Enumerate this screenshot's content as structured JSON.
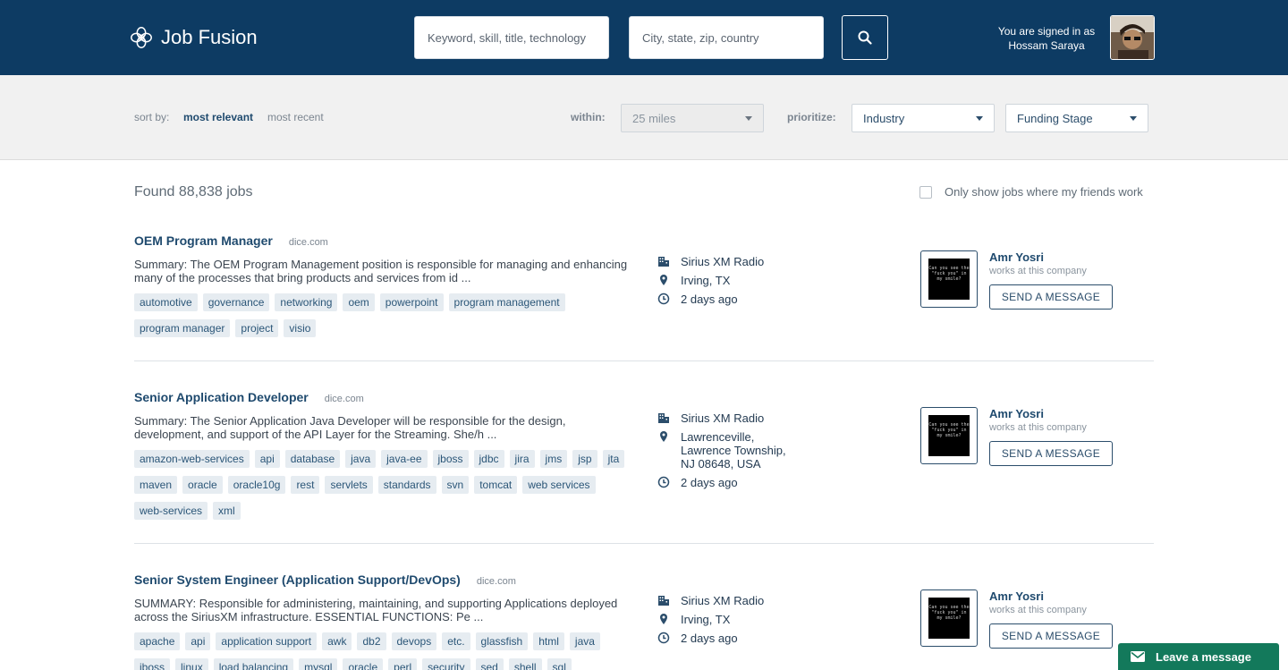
{
  "header": {
    "app_name": "Job Fusion",
    "keyword_placeholder": "Keyword, skill, title, technology",
    "location_placeholder": "City, state, zip, country",
    "signed_in_label": "You are signed in as",
    "user_name": "Hossam Saraya"
  },
  "filters": {
    "sort_by_label": "sort by:",
    "sort_options": [
      "most relevant",
      "most recent"
    ],
    "sort_active": "most relevant",
    "within_label": "within:",
    "within_value": "25 miles",
    "prioritize_label": "prioritize:",
    "prioritize_value": "Industry",
    "funding_value": "Funding Stage"
  },
  "results": {
    "found_text": "Found 88,838 jobs",
    "friends_filter_label": "Only show jobs where my friends work"
  },
  "jobs": [
    {
      "title": "OEM Program Manager",
      "source": "dice.com",
      "summary": "Summary: The OEM Program Management position is responsible for managing and enhancing many of the processes that bring products and services from id ...",
      "tags": [
        "automotive",
        "governance",
        "networking",
        "oem",
        "powerpoint",
        "program management",
        "program manager",
        "project",
        "visio"
      ],
      "company": "Sirius XM Radio",
      "location": "Irving, TX",
      "posted": "2 days ago",
      "contact_name": "Amr Yosri",
      "contact_sub": "works at this company",
      "message_label": "SEND A MESSAGE"
    },
    {
      "title": "Senior Application Developer",
      "source": "dice.com",
      "summary": "Summary: The Senior Application Java Developer will be responsible for the design, development, and support of the API Layer for the Streaming. She/h ...",
      "tags": [
        "amazon-web-services",
        "api",
        "database",
        "java",
        "java-ee",
        "jboss",
        "jdbc",
        "jira",
        "jms",
        "jsp",
        "jta",
        "maven",
        "oracle",
        "oracle10g",
        "rest",
        "servlets",
        "standards",
        "svn",
        "tomcat",
        "web services",
        "web-services",
        "xml"
      ],
      "company": "Sirius XM Radio",
      "location": "Lawrenceville, Lawrence Township, NJ 08648, USA",
      "posted": "2 days ago",
      "contact_name": "Amr Yosri",
      "contact_sub": "works at this company",
      "message_label": "SEND A MESSAGE"
    },
    {
      "title": "Senior System Engineer (Application Support/DevOps)",
      "source": "dice.com",
      "summary": "SUMMARY: Responsible for administering, maintaining, and supporting Applications deployed across the SiriusXM infrastructure. ESSENTIAL FUNCTIONS: Pe ...",
      "tags": [
        "apache",
        "api",
        "application support",
        "awk",
        "db2",
        "devops",
        "etc.",
        "glassfish",
        "html",
        "java",
        "jboss",
        "linux",
        "load balancing",
        "mysql",
        "oracle",
        "perl",
        "security",
        "sed",
        "shell",
        "sql"
      ],
      "company": "Sirius XM Radio",
      "location": "Irving, TX",
      "posted": "2 days ago",
      "contact_name": "Amr Yosri",
      "contact_sub": "works at this company",
      "message_label": "SEND A MESSAGE"
    }
  ],
  "thumb_text": "Can you see the \"fuck you\" in my smile?",
  "chat": {
    "label": "Leave a message"
  },
  "colors": {
    "header_bg": "#0d3b63",
    "chat_bg": "#13795b",
    "tag_bg": "#e6ecf1"
  }
}
